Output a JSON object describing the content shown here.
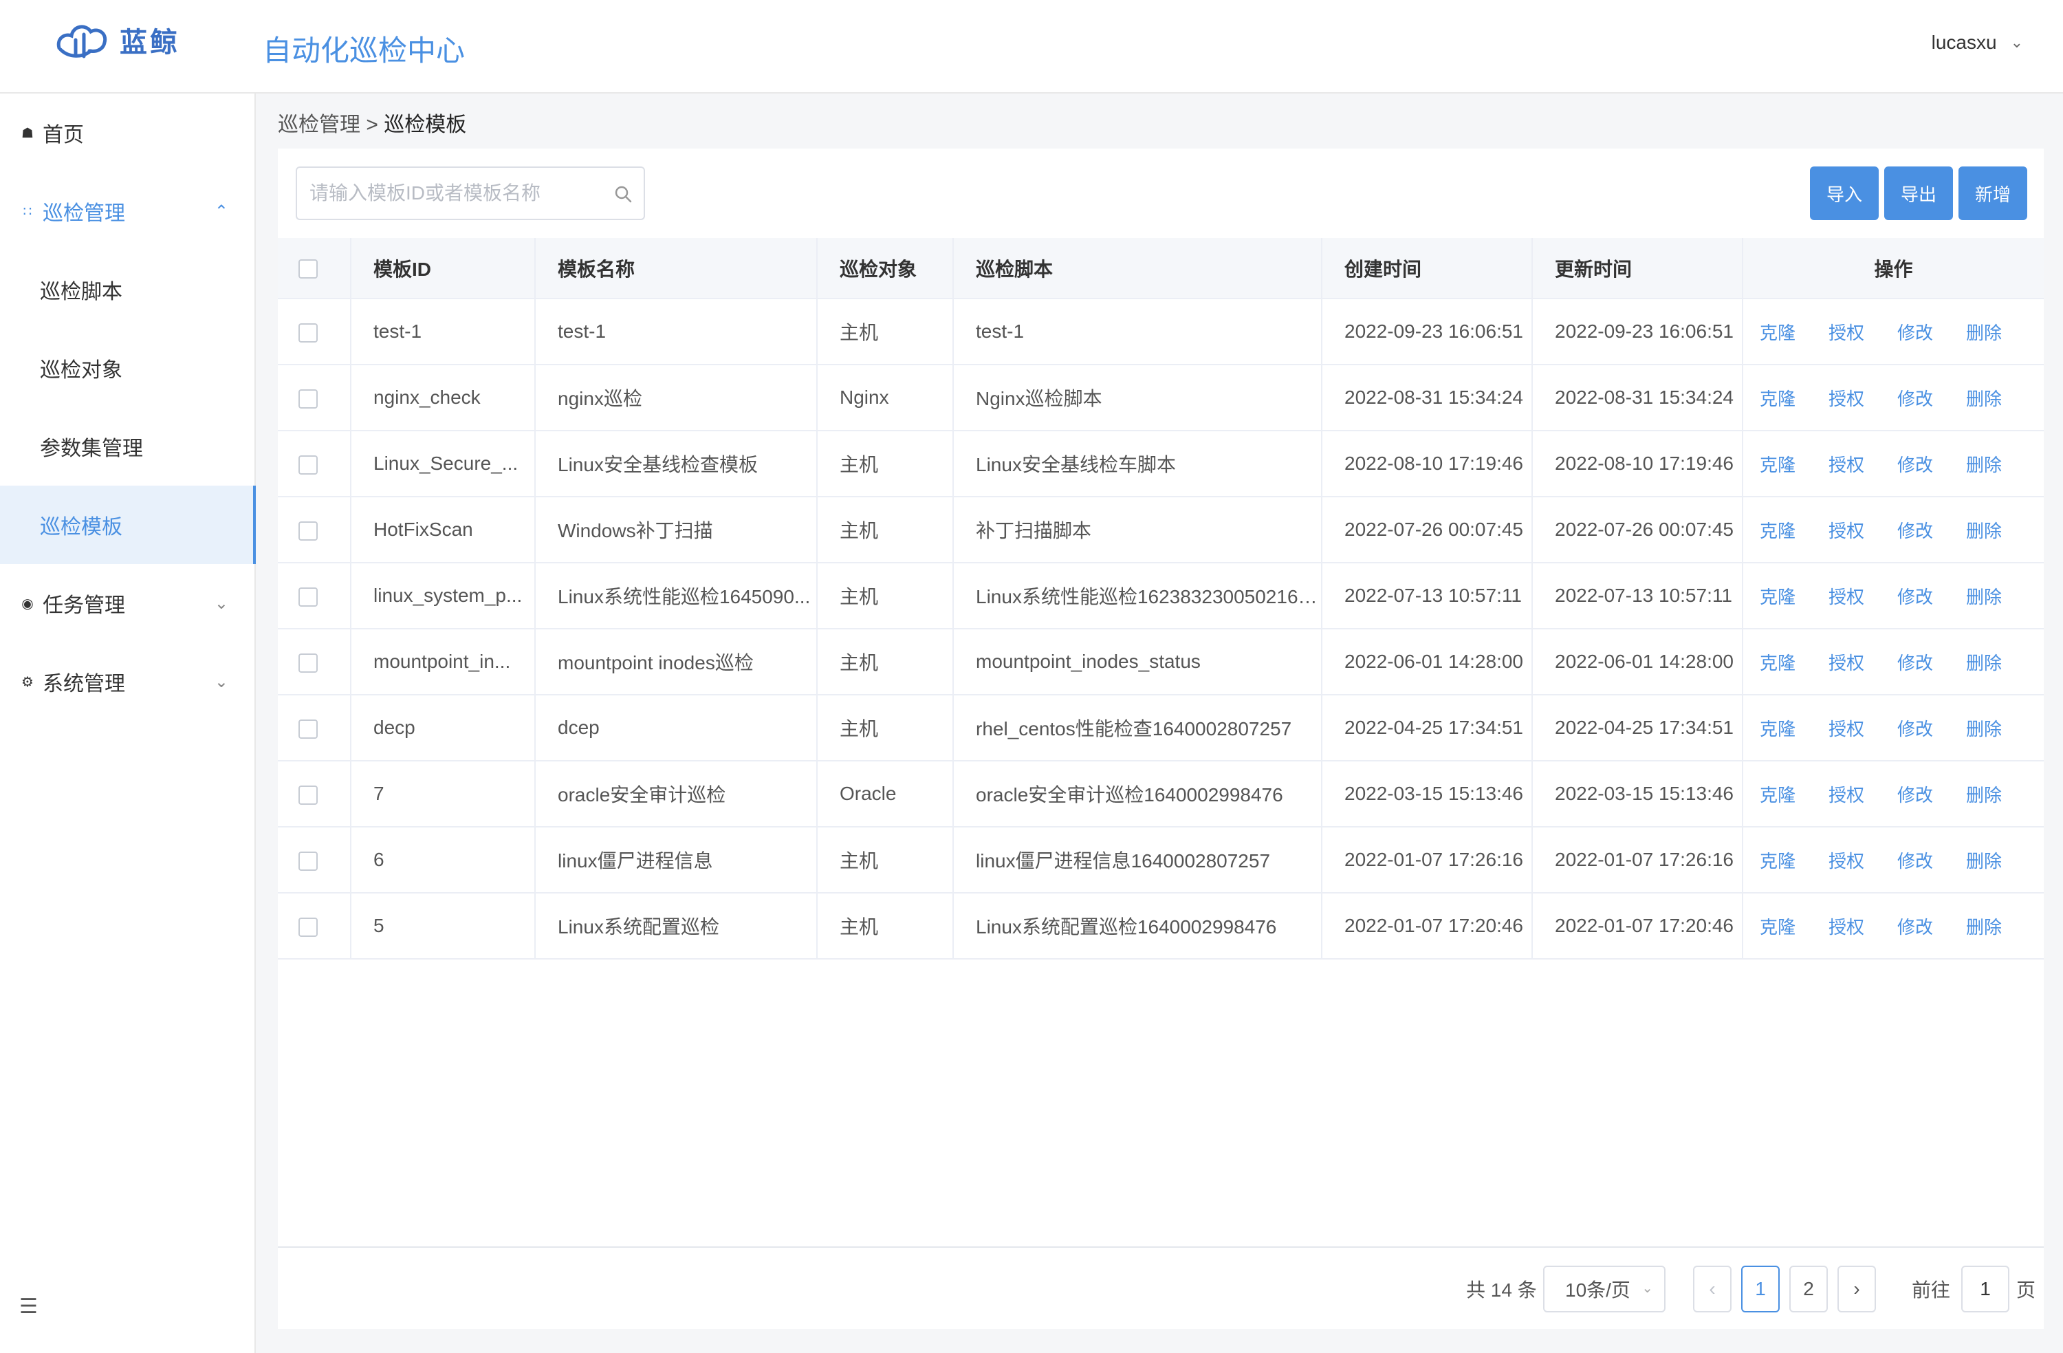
{
  "header": {
    "logo_text": "蓝鲸",
    "app_title": "自动化巡检中心",
    "username": "lucasxu"
  },
  "sidebar": {
    "items": [
      {
        "label": "首页",
        "icon": "home-icon"
      },
      {
        "label": "巡检管理",
        "icon": "grid-icon"
      },
      {
        "label": "巡检脚本"
      },
      {
        "label": "巡检对象"
      },
      {
        "label": "参数集管理"
      },
      {
        "label": "巡检模板"
      },
      {
        "label": "任务管理",
        "icon": "task-icon"
      },
      {
        "label": "系统管理",
        "icon": "gear-icon"
      }
    ]
  },
  "breadcrumb": {
    "parent": "巡检管理",
    "separator": ">",
    "current": "巡检模板"
  },
  "toolbar": {
    "search_placeholder": "请输入模板ID或者模板名称",
    "search_value": "",
    "import_label": "导入",
    "export_label": "导出",
    "new_label": "新增"
  },
  "table": {
    "columns": [
      "模板ID",
      "模板名称",
      "巡检对象",
      "巡检脚本",
      "创建时间",
      "更新时间",
      "操作"
    ],
    "actions": [
      "克隆",
      "授权",
      "修改",
      "删除"
    ],
    "rows": [
      {
        "id": "test-1",
        "name": "test-1",
        "target": "主机",
        "script": "test-1",
        "created": "2022-09-23 16:06:51",
        "updated": "2022-09-23 16:06:51"
      },
      {
        "id": "nginx_check",
        "name": "nginx巡检",
        "target": "Nginx",
        "script": "Nginx巡检脚本",
        "created": "2022-08-31 15:34:24",
        "updated": "2022-08-31 15:34:24"
      },
      {
        "id": "Linux_Secure_...",
        "name": "Linux安全基线检查模板",
        "target": "主机",
        "script": "Linux安全基线检车脚本",
        "created": "2022-08-10 17:19:46",
        "updated": "2022-08-10 17:19:46"
      },
      {
        "id": "HotFixScan",
        "name": "Windows补丁扫描",
        "target": "主机",
        "script": "补丁扫描脚本",
        "created": "2022-07-26 00:07:45",
        "updated": "2022-07-26 00:07:45"
      },
      {
        "id": "linux_system_p...",
        "name": "Linux系统性能巡检1645090...",
        "target": "主机",
        "script": "Linux系统性能巡检1623832300502164...",
        "created": "2022-07-13 10:57:11",
        "updated": "2022-07-13 10:57:11"
      },
      {
        "id": "mountpoint_in...",
        "name": "mountpoint inodes巡检",
        "target": "主机",
        "script": "mountpoint_inodes_status",
        "created": "2022-06-01 14:28:00",
        "updated": "2022-06-01 14:28:00"
      },
      {
        "id": "decp",
        "name": "dcep",
        "target": "主机",
        "script": "rhel_centos性能检查1640002807257",
        "created": "2022-04-25 17:34:51",
        "updated": "2022-04-25 17:34:51"
      },
      {
        "id": "7",
        "name": "oracle安全审计巡检",
        "target": "Oracle",
        "script": "oracle安全审计巡检1640002998476",
        "created": "2022-03-15 15:13:46",
        "updated": "2022-03-15 15:13:46"
      },
      {
        "id": "6",
        "name": "linux僵尸进程信息",
        "target": "主机",
        "script": "linux僵尸进程信息1640002807257",
        "created": "2022-01-07 17:26:16",
        "updated": "2022-01-07 17:26:16"
      },
      {
        "id": "5",
        "name": "Linux系统配置巡检",
        "target": "主机",
        "script": "Linux系统配置巡检1640002998476",
        "created": "2022-01-07 17:20:46",
        "updated": "2022-01-07 17:20:46"
      }
    ]
  },
  "pagination": {
    "total_text": "共 14 条",
    "page_size": "10条/页",
    "pages": [
      "1",
      "2"
    ],
    "current_page": "1",
    "goto_prefix": "前往",
    "goto_value": "1",
    "goto_suffix": "页"
  },
  "colors": {
    "accent": "#4a90e2",
    "active_bg": "#e8f1fb"
  }
}
